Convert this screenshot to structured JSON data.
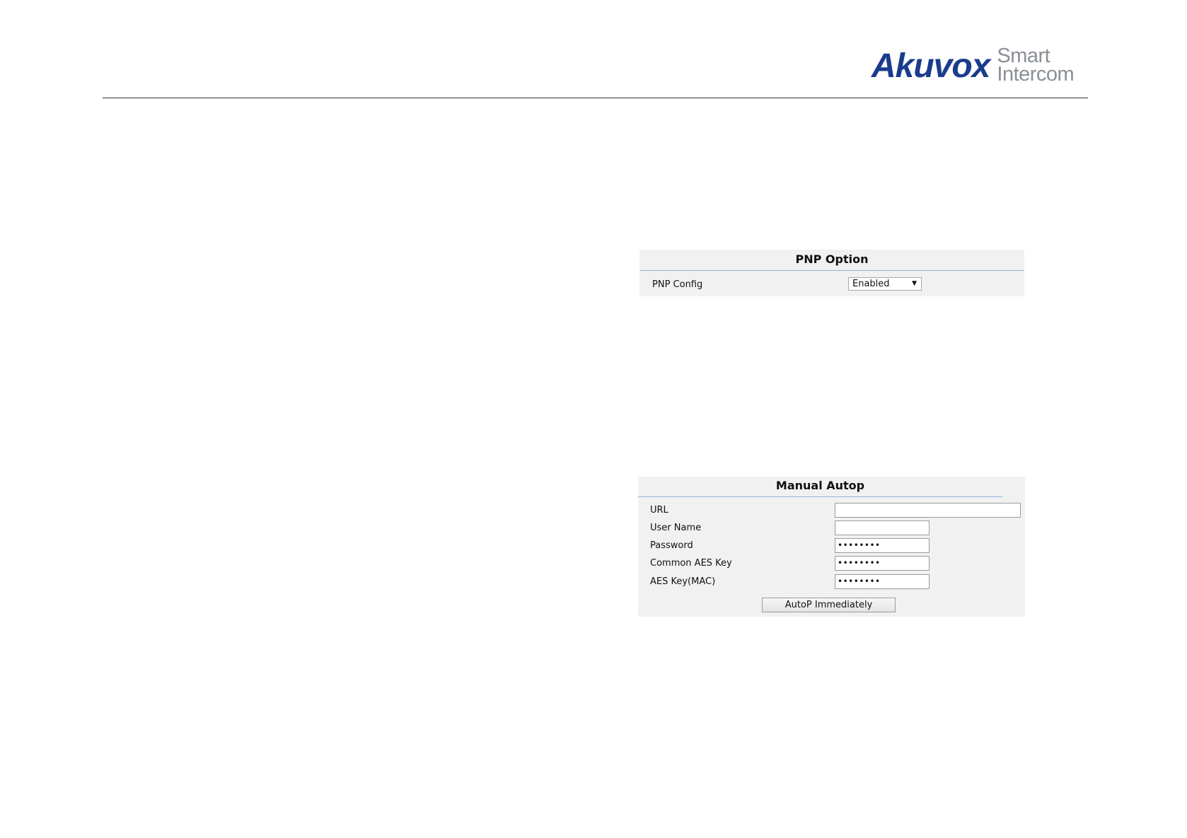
{
  "header": {
    "logo_word": "Akuvox",
    "logo_tag_line1": "Smart",
    "logo_tag_line2": "Intercom",
    "brand_color": "#1b3c8c"
  },
  "pnp_option": {
    "title": "PNP Option",
    "pnp_config_label": "PNP Config",
    "pnp_config_value": "Enabled",
    "dropdown_icon": "caret-down-icon"
  },
  "manual_autop": {
    "title": "Manual Autop",
    "url_label": "URL",
    "url_value": "",
    "username_label": "User Name",
    "username_value": "",
    "password_label": "Password",
    "password_value": "••••••••",
    "common_aes_label": "Common AES Key",
    "common_aes_value": "••••••••",
    "aes_mac_label": "AES Key(MAC)",
    "aes_mac_value": "••••••••",
    "button_label": "AutoP Immediately"
  }
}
